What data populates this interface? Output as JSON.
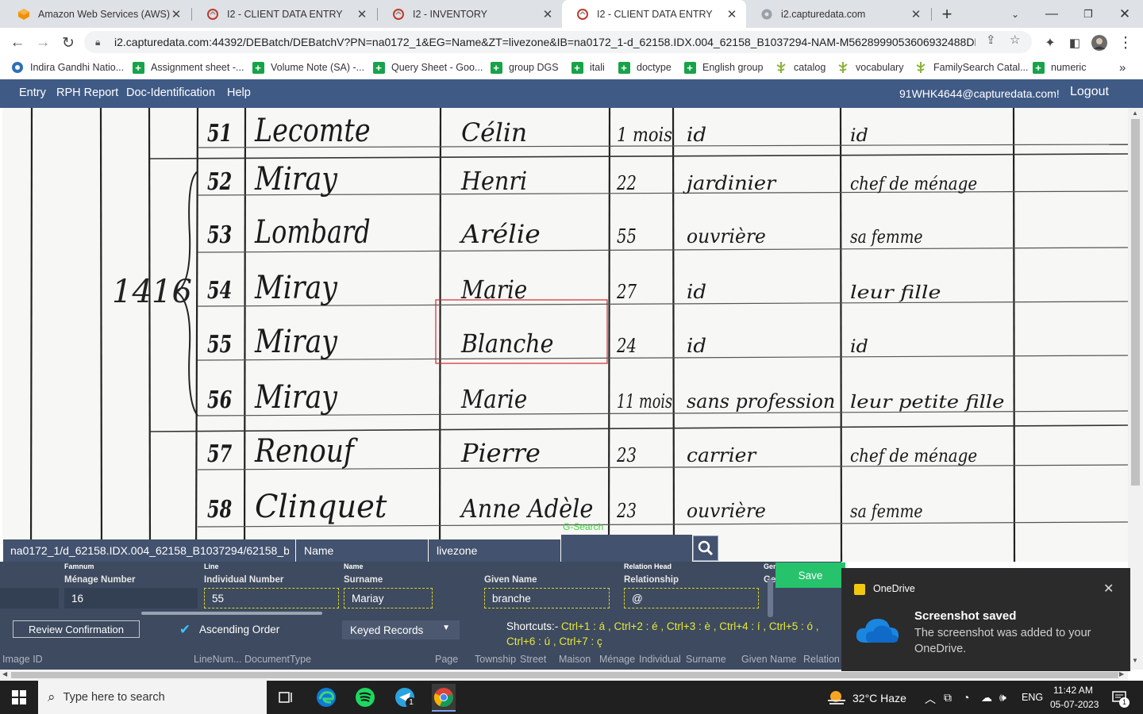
{
  "browser": {
    "tabs": [
      {
        "label": "Amazon Web Services (AWS)",
        "icon": "aws-icon",
        "active": false
      },
      {
        "label": "I2 - CLIENT DATA ENTRY",
        "icon": "capturedata-icon",
        "active": false
      },
      {
        "label": "I2 - INVENTORY",
        "icon": "capturedata-icon",
        "active": false
      },
      {
        "label": "I2 - CLIENT DATA ENTRY",
        "icon": "capturedata-icon",
        "active": true
      },
      {
        "label": "i2.capturedata.com",
        "icon": "globe-icon",
        "active": false
      }
    ],
    "close_glyph": "✕",
    "new_tab_glyph": "+",
    "url": "i2.capturedata.com:44392/DEBatch/DEBatchV?PN=na0172_1&EG=Name&ZT=livezone&IB=na0172_1-d_62158.IDX.004_62158_B1037294-NAM-M5628999053606932488DBID...",
    "bookmarks": [
      {
        "label": "Indira Gandhi Natio...",
        "icon": "ignou-icon"
      },
      {
        "label": "Assignment sheet -...",
        "icon": "sheets-plus-icon"
      },
      {
        "label": "Volume Note (SA) -...",
        "icon": "sheets-plus-icon"
      },
      {
        "label": "Query Sheet - Goo...",
        "icon": "sheets-plus-icon"
      },
      {
        "label": "group DGS",
        "icon": "sheets-plus-icon"
      },
      {
        "label": "itali",
        "icon": "sheets-plus-icon"
      },
      {
        "label": "doctype",
        "icon": "sheets-plus-icon"
      },
      {
        "label": "English group",
        "icon": "sheets-plus-icon"
      },
      {
        "label": "catalog",
        "icon": "familysearch-icon"
      },
      {
        "label": "vocabulary",
        "icon": "familysearch-icon"
      },
      {
        "label": "FamilySearch Catal...",
        "icon": "familysearch-icon"
      },
      {
        "label": "numeric",
        "icon": "sheets-plus-icon"
      }
    ],
    "more_bookmarks_glyph": "»"
  },
  "app_nav": {
    "items": [
      "Entry",
      "RPH Report",
      "Doc-Identification",
      "Help"
    ],
    "user": "91WHK4644@capturedata.com!",
    "logout": "Logout"
  },
  "document_image": {
    "line_numbers": [
      "51",
      "52",
      "53",
      "54",
      "55",
      "56",
      "57",
      "58"
    ],
    "surnames": [
      "Lecomte",
      "Miray",
      "Lombard",
      "Miray",
      "Miray",
      "Miray",
      "Renouf",
      "Clinquet"
    ],
    "given_names": [
      "Célin",
      "Henri",
      "Arélie",
      "Marie",
      "Blanche",
      "Marie",
      "Pierre",
      "Anne Adèle"
    ],
    "ages": [
      "1 mois",
      "22",
      "55",
      "27",
      "24",
      "11 mois",
      "23",
      "23"
    ],
    "occupations": [
      "id",
      "jardinier",
      "ouvrière",
      "id",
      "id",
      "sans profession",
      "carrier",
      "ouvrière"
    ],
    "relations": [
      "id",
      "chef de ménage",
      "sa femme",
      "leur fille",
      "id",
      "leur petite fille",
      "chef de ménage",
      "sa femme"
    ],
    "menage_marks": [
      "14",
      "16"
    ]
  },
  "search_strip": {
    "image_path": "na0172_1/d_62158.IDX.004_62158_B1037294/62158_b1037...",
    "field": "Name",
    "zone": "livezone",
    "search_hint": "G-Search",
    "search_value": ""
  },
  "form": {
    "small_labels": {
      "famnum": "Famnum",
      "line": "Line",
      "name": "Name",
      "relation_head": "Relation Head",
      "gen": "Gen"
    },
    "labels": {
      "menage_number": "Ménage Number",
      "individual_number": "Individual Number",
      "surname": "Surname",
      "given_name": "Given Name",
      "relationship": "Relationship",
      "gen2": "Ge"
    },
    "values": {
      "famnum": "",
      "menage_number": "16",
      "individual_number": "55",
      "surname": "Mariay",
      "given_name": "branche",
      "relationship": "@"
    },
    "save": "Save",
    "review_confirmation": "Review Confirmation",
    "ascending_order": "Ascending Order",
    "ascending_checked": true,
    "records_dropdown": "Keyed Records",
    "shortcuts_title": "Shortcuts:-",
    "shortcuts": "Ctrl+1 : á , Ctrl+2 : é , Ctrl+3 : è , Ctrl+4 : í , Ctrl+5 : ó , Ctrl+6 : ú , Ctrl+7 : ç",
    "grid_columns": [
      "Image ID",
      "LineNum...",
      "DocumentType",
      "Page",
      "Township",
      "Street",
      "Maison",
      "Ménage",
      "Individual",
      "Surname",
      "Given Name",
      "Relation"
    ]
  },
  "toast": {
    "app": "OneDrive",
    "title": "Screenshot saved",
    "body": "The screenshot was added to your OneDrive.",
    "close_glyph": "✕"
  },
  "taskbar": {
    "search_placeholder": "Type here to search",
    "weather": "32°C  Haze",
    "language": "ENG",
    "time": "11:42 AM",
    "date": "05-07-2023",
    "notification_count": "1",
    "telegram_badge": "1"
  },
  "colors": {
    "app_nav": "#3f5a85",
    "form_bg": "#3d4a5f",
    "save_button": "#26c26c",
    "field_border": "#d8d42a",
    "shortcut_text": "#e8e83a",
    "highlight_box": "#d22b2b"
  }
}
